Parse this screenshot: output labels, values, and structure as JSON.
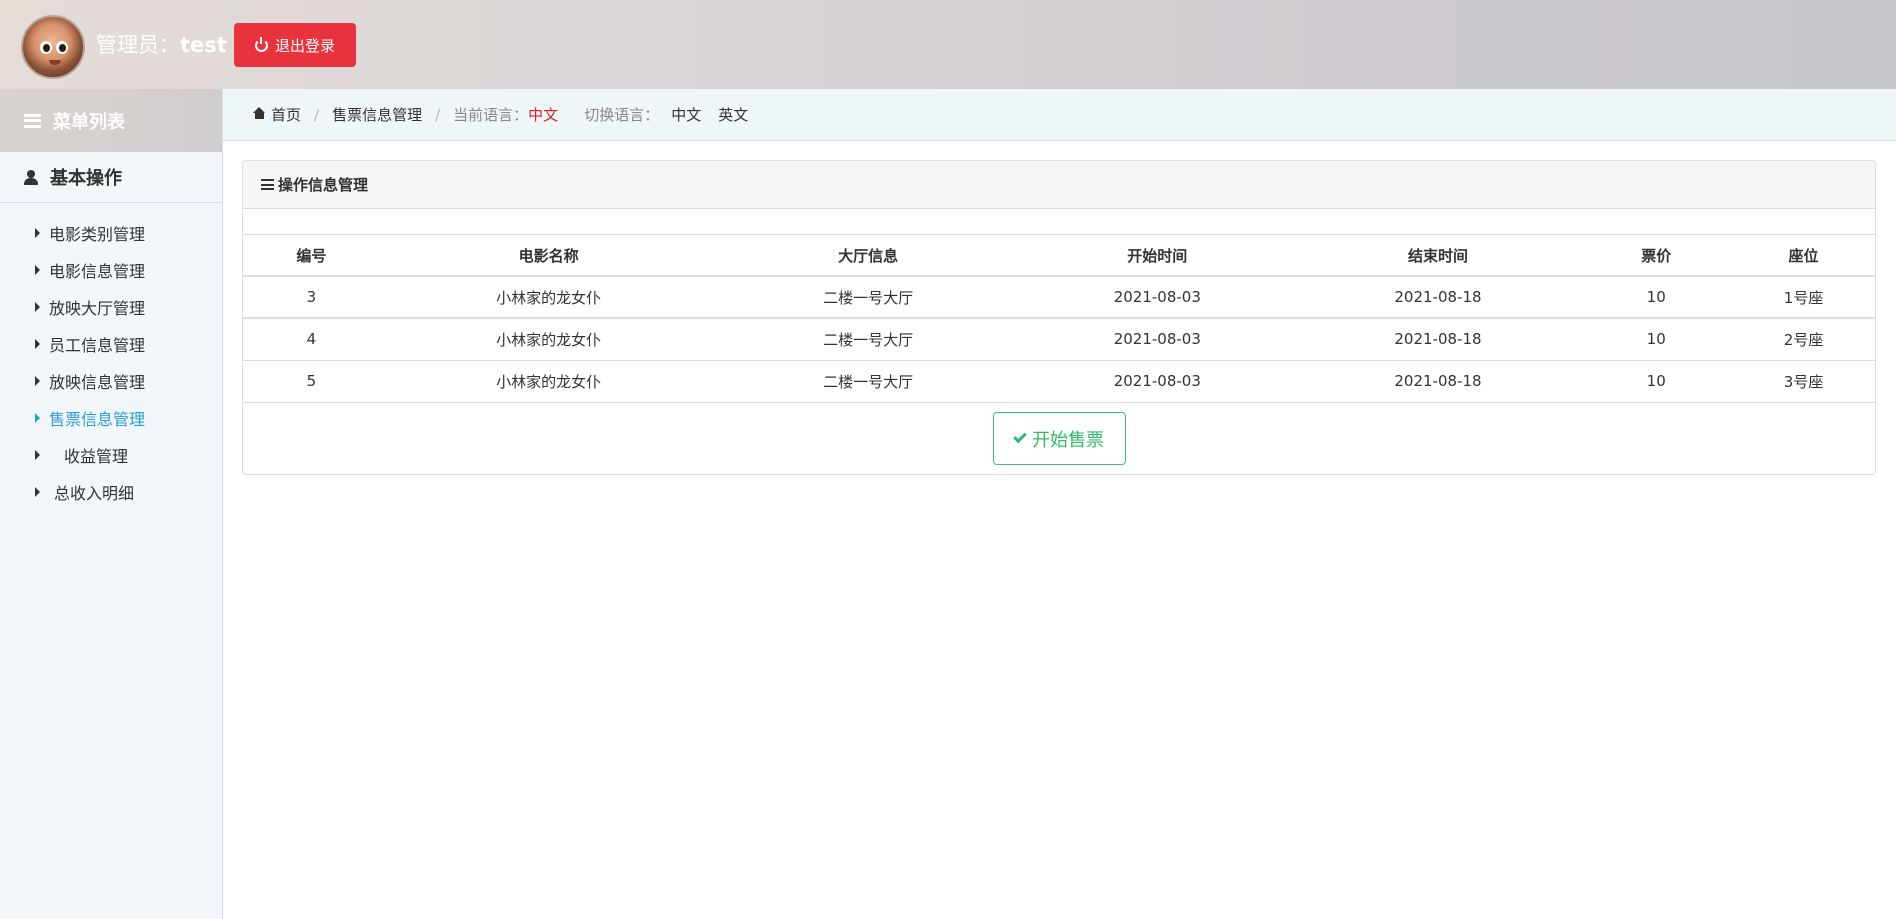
{
  "header": {
    "admin_prefix": "管理员：",
    "admin_name": "test",
    "logout_label": "退出登录"
  },
  "sidebar": {
    "menu_title": "菜单列表",
    "section_title": "基本操作",
    "items": [
      {
        "label": "电影类别管理",
        "active": false
      },
      {
        "label": "电影信息管理",
        "active": false
      },
      {
        "label": "放映大厅管理",
        "active": false
      },
      {
        "label": "员工信息管理",
        "active": false
      },
      {
        "label": "放映信息管理",
        "active": false
      },
      {
        "label": "售票信息管理",
        "active": true
      },
      {
        "label": "收益管理",
        "active": false
      },
      {
        "label": "总收入明细",
        "active": false
      }
    ]
  },
  "breadcrumb": {
    "home": "首页",
    "current": "售票信息管理",
    "current_lang_label": "当前语言：",
    "current_lang": "中文",
    "switch_lang_label": "切换语言：",
    "lang_zh": "中文",
    "lang_en": "英文"
  },
  "panel": {
    "title": "操作信息管理",
    "columns": [
      "编号",
      "电影名称",
      "大厅信息",
      "开始时间",
      "结束时间",
      "票价",
      "座位"
    ],
    "rows": [
      [
        "3",
        "小林家的龙女仆",
        "二楼一号大厅",
        "2021-08-03",
        "2021-08-18",
        "10",
        "1号座"
      ],
      [
        "4",
        "小林家的龙女仆",
        "二楼一号大厅",
        "2021-08-03",
        "2021-08-18",
        "10",
        "2号座"
      ],
      [
        "5",
        "小林家的龙女仆",
        "二楼一号大厅",
        "2021-08-03",
        "2021-08-18",
        "10",
        "3号座"
      ]
    ],
    "sell_label": "开始售票"
  },
  "colors": {
    "logout_red": "#e8323d",
    "active_blue": "#2a9fd6",
    "lang_red": "#e02020",
    "sell_green": "#2ebd67"
  }
}
